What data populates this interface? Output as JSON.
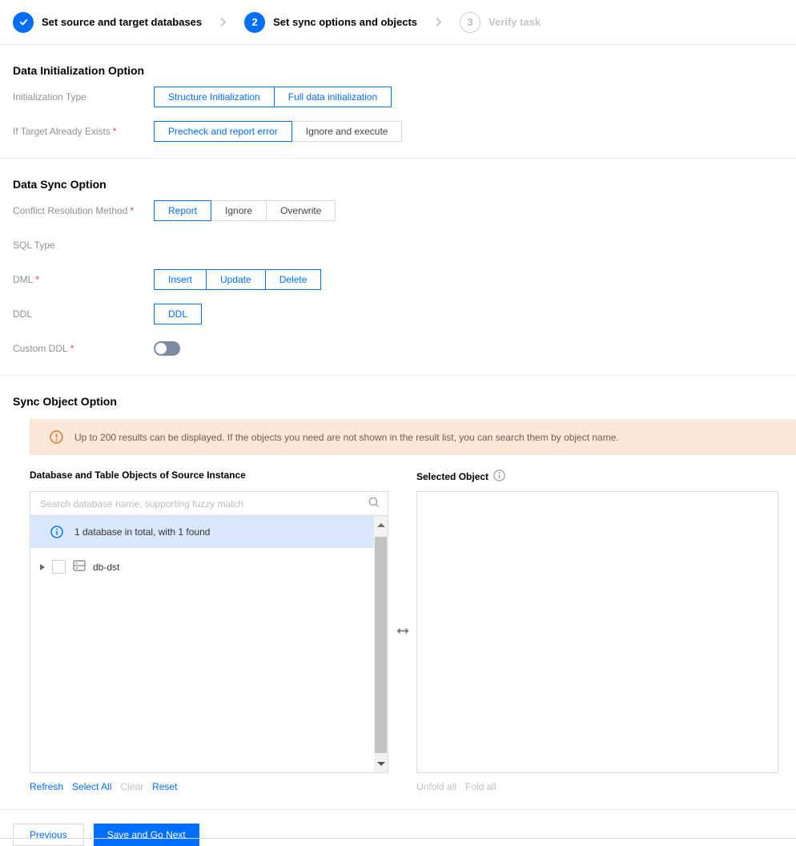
{
  "ui": {
    "required_mark": "*"
  },
  "colors": {
    "accent_blue": "#006eff",
    "banner_bg": "#fce8d9",
    "banner_icon": "#ed7b2f",
    "info_bg": "#d9e8fb",
    "toggle_off": "#7c8ba1",
    "required_red": "#e54545"
  },
  "icons": {
    "step_done": "check-in-blue-circle",
    "step_separator": "chevron-right",
    "banner": "exclamation-circle",
    "info": "i-in-circle",
    "search": "magnifier",
    "database": "database-server",
    "swap": "left-right-arrow"
  },
  "stepper": {
    "steps": [
      {
        "label": "Set source and target databases",
        "status": "done"
      },
      {
        "number": "2",
        "label": "Set sync options and objects",
        "status": "active"
      },
      {
        "number": "3",
        "label": "Verify task",
        "status": "pending"
      }
    ]
  },
  "data_initialization": {
    "title": "Data Initialization Option",
    "initialization_type": {
      "label": "Initialization Type",
      "options": [
        {
          "label": "Structure Initialization",
          "selected": true
        },
        {
          "label": "Full data initialization",
          "selected": true
        }
      ]
    },
    "if_target_exists": {
      "label": "If Target Already Exists",
      "required": true,
      "options": [
        {
          "label": "Precheck and report error",
          "selected": true
        },
        {
          "label": "Ignore and execute",
          "selected": false
        }
      ]
    }
  },
  "data_sync": {
    "title": "Data Sync Option",
    "conflict_resolution": {
      "label": "Conflict Resolution Method",
      "required": true,
      "options": [
        {
          "label": "Report",
          "selected": true
        },
        {
          "label": "Ignore",
          "selected": false
        },
        {
          "label": "Overwrite",
          "selected": false
        }
      ]
    },
    "sql_type": {
      "label": "SQL Type"
    },
    "dml": {
      "label": "DML",
      "required": true,
      "options": [
        {
          "label": "Insert",
          "selected": true
        },
        {
          "label": "Update",
          "selected": true
        },
        {
          "label": "Delete",
          "selected": true
        }
      ]
    },
    "ddl": {
      "label": "DDL",
      "options": [
        {
          "label": "DDL",
          "selected": true
        }
      ]
    },
    "custom_ddl": {
      "label": "Custom DDL",
      "required": true,
      "state": "off"
    }
  },
  "sync_object": {
    "title": "Sync Object Option",
    "notice": "Up to 200 results can be displayed. If the objects you need are not shown in the result list, you can search them by object name.",
    "source_panel": {
      "title": "Database and Table Objects of Source Instance",
      "search_placeholder": "Search database name, supporting fuzzy match",
      "search_value": "",
      "info": "1 database in total, with 1 found",
      "tree": [
        {
          "name": "db-dst",
          "checked": false,
          "expanded": false
        }
      ],
      "actions": [
        {
          "label": "Refresh",
          "enabled": true
        },
        {
          "label": "Select All",
          "enabled": true
        },
        {
          "label": "Clear",
          "enabled": false
        },
        {
          "label": "Reset",
          "enabled": true
        }
      ]
    },
    "selected_panel": {
      "title": "Selected Object",
      "actions": [
        {
          "label": "Unfold all",
          "enabled": false
        },
        {
          "label": "Fold all",
          "enabled": false
        }
      ]
    }
  },
  "footer": {
    "previous_label": "Previous",
    "save_label": "Save and Go Next"
  }
}
